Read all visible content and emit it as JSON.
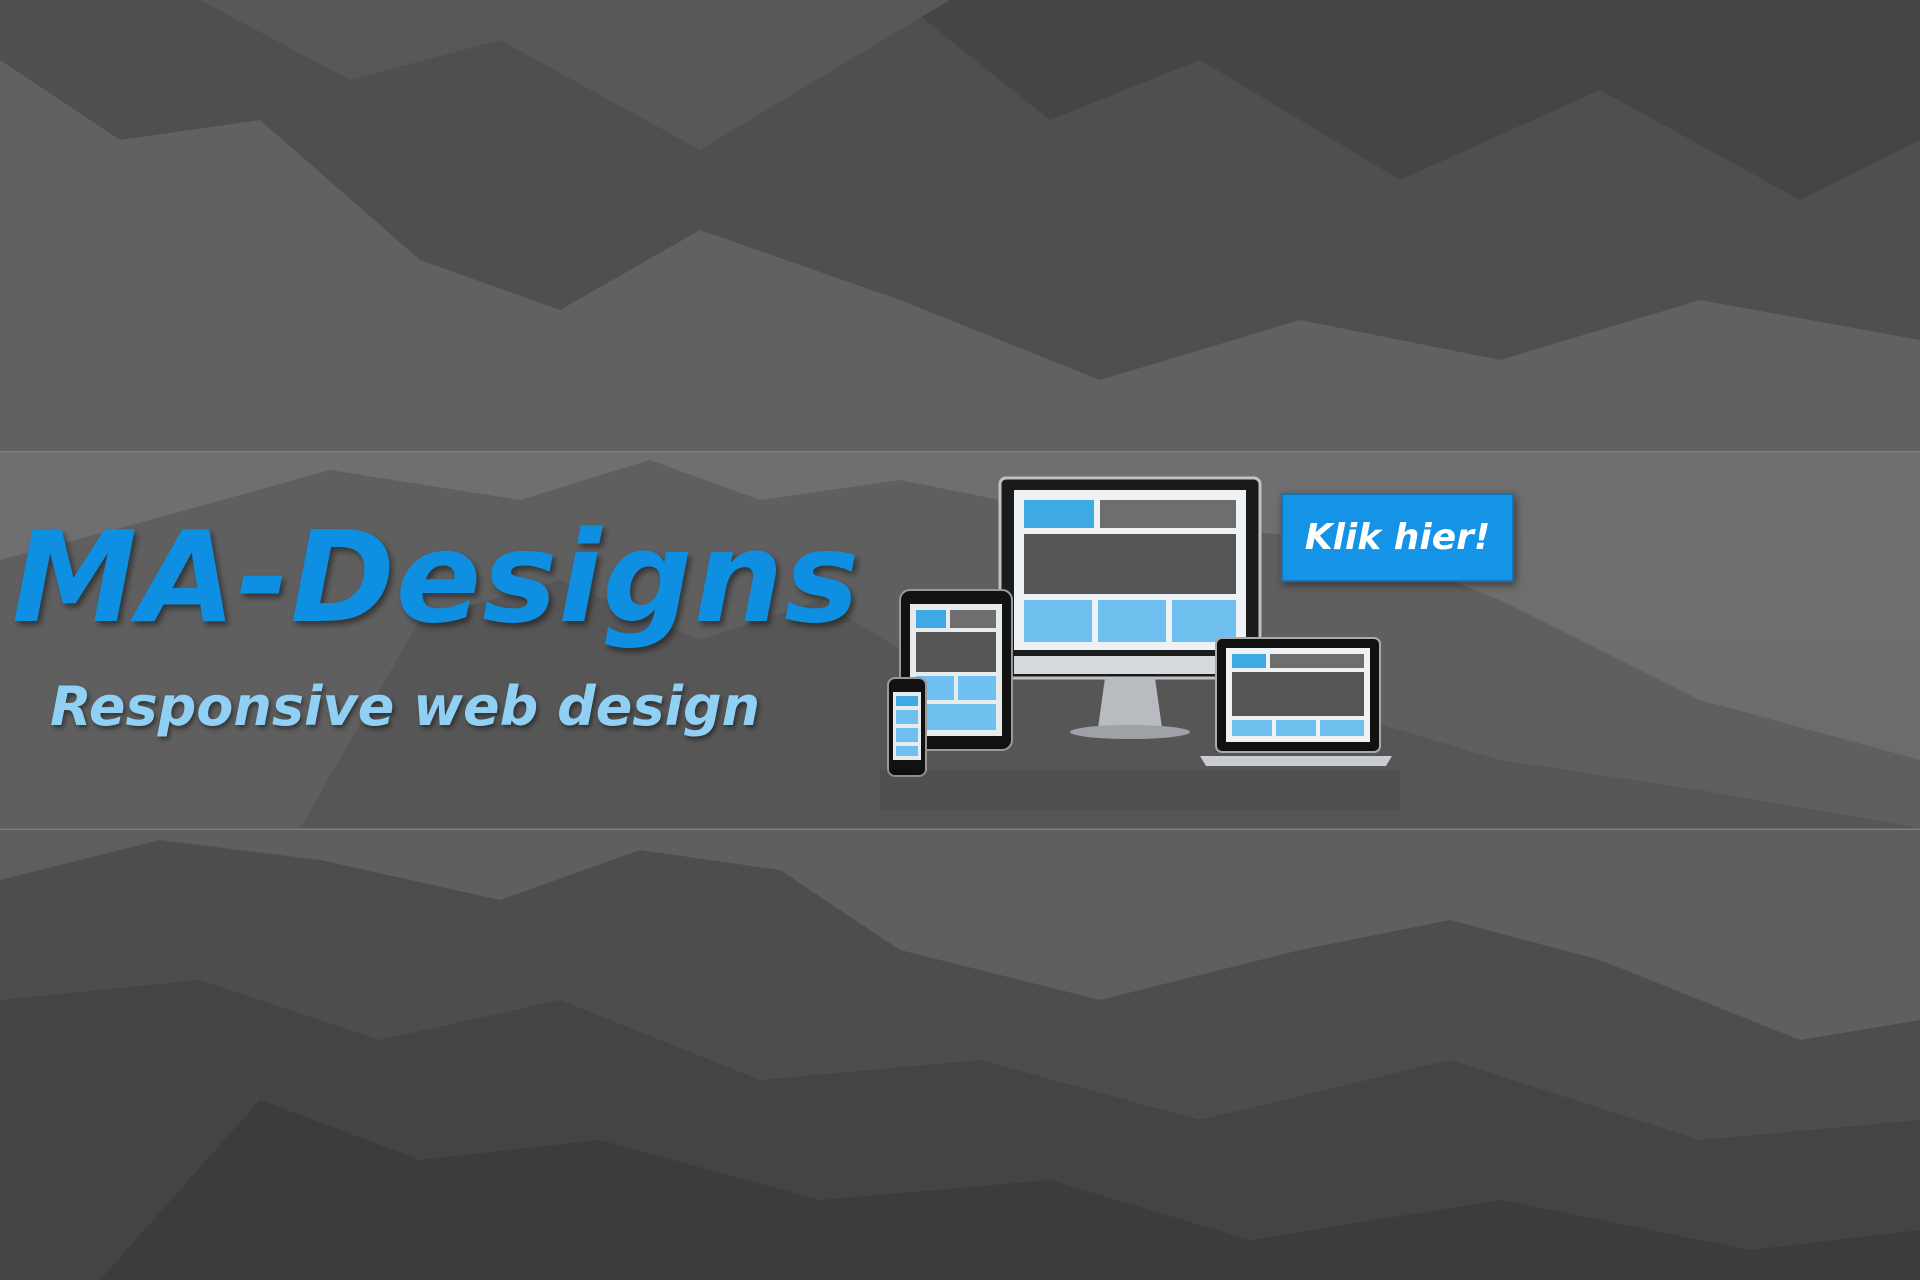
{
  "brand": {
    "title": "MA-Designs",
    "tagline": "Responsive web design",
    "title_color": "#0e8fe2",
    "tagline_color": "#8fd0f4"
  },
  "cta": {
    "label": "Klik hier!",
    "color": "#1593e6"
  },
  "illustration": {
    "icon": "responsive-devices-icon",
    "accent": "#3fa9e6"
  }
}
